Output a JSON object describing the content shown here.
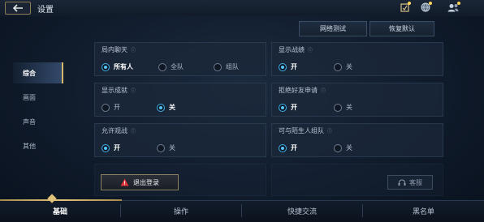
{
  "header": {
    "title": "设置",
    "icons": [
      "mission-icon",
      "globe-icon",
      "friends-icon"
    ]
  },
  "actions": {
    "network_test": "网络测试",
    "restore_default": "恢复默认"
  },
  "sidebar": {
    "items": [
      {
        "label": "综合",
        "active": true
      },
      {
        "label": "画面",
        "active": false
      },
      {
        "label": "声音",
        "active": false
      },
      {
        "label": "其他",
        "active": false
      }
    ]
  },
  "settings": [
    {
      "title": "局内聊天",
      "options": [
        "所有人",
        "全队",
        "组队"
      ],
      "selected": 0
    },
    {
      "title": "显示战绩",
      "options": [
        "开",
        "关"
      ],
      "selected": 0
    },
    {
      "title": "显示成就",
      "options": [
        "开",
        "关"
      ],
      "selected": 1
    },
    {
      "title": "拒绝好友申请",
      "options": [
        "开",
        "关"
      ],
      "selected": 0
    },
    {
      "title": "允许观战",
      "options": [
        "开",
        "关"
      ],
      "selected": 0
    },
    {
      "title": "可与陌生人组队",
      "options": [
        "开",
        "关"
      ],
      "selected": 0
    }
  ],
  "footer": {
    "logout": "退出登录",
    "service": "客服"
  },
  "bottom_tabs": [
    {
      "label": "基础",
      "active": true
    },
    {
      "label": "操作",
      "active": false
    },
    {
      "label": "快捷交流",
      "active": false
    },
    {
      "label": "黑名单",
      "active": false
    }
  ],
  "colors": {
    "accent_gold": "#d6b66b",
    "radio_selected": "#55c6ff",
    "warning": "#e0343a"
  }
}
